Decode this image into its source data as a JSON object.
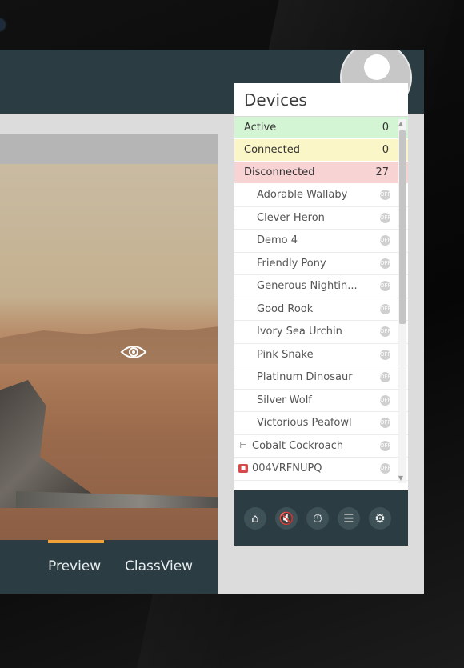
{
  "tabs": {
    "preview": "Preview",
    "classview": "ClassView"
  },
  "devices": {
    "title": "Devices",
    "status": [
      {
        "label": "Active",
        "count": "0"
      },
      {
        "label": "Connected",
        "count": "0"
      },
      {
        "label": "Disconnected",
        "count": "27"
      }
    ],
    "items": [
      {
        "name": "Adorable Wallaby"
      },
      {
        "name": "Clever Heron"
      },
      {
        "name": "Demo 4"
      },
      {
        "name": "Friendly Pony"
      },
      {
        "name": "Generous Nightin..."
      },
      {
        "name": "Good Rook"
      },
      {
        "name": "Ivory Sea Urchin"
      },
      {
        "name": "Pink Snake"
      },
      {
        "name": "Platinum Dinosaur"
      },
      {
        "name": "Silver Wolf"
      },
      {
        "name": "Victorious Peafowl"
      },
      {
        "name": "Cobalt Cockroach",
        "lead_icon": "bed-icon"
      },
      {
        "name": "004VRFNUPQ",
        "lead_icon": "red-device-icon"
      }
    ],
    "toolbar_icons": [
      "home-icon",
      "mute-icon",
      "timer-icon",
      "filter-icon",
      "settings-icon"
    ]
  },
  "colors": {
    "bar": "#2b3d43",
    "accent": "#f0a23a",
    "active": "#d4f5d4",
    "connected": "#fbf6c7",
    "disconnected": "#f8d3d3"
  }
}
